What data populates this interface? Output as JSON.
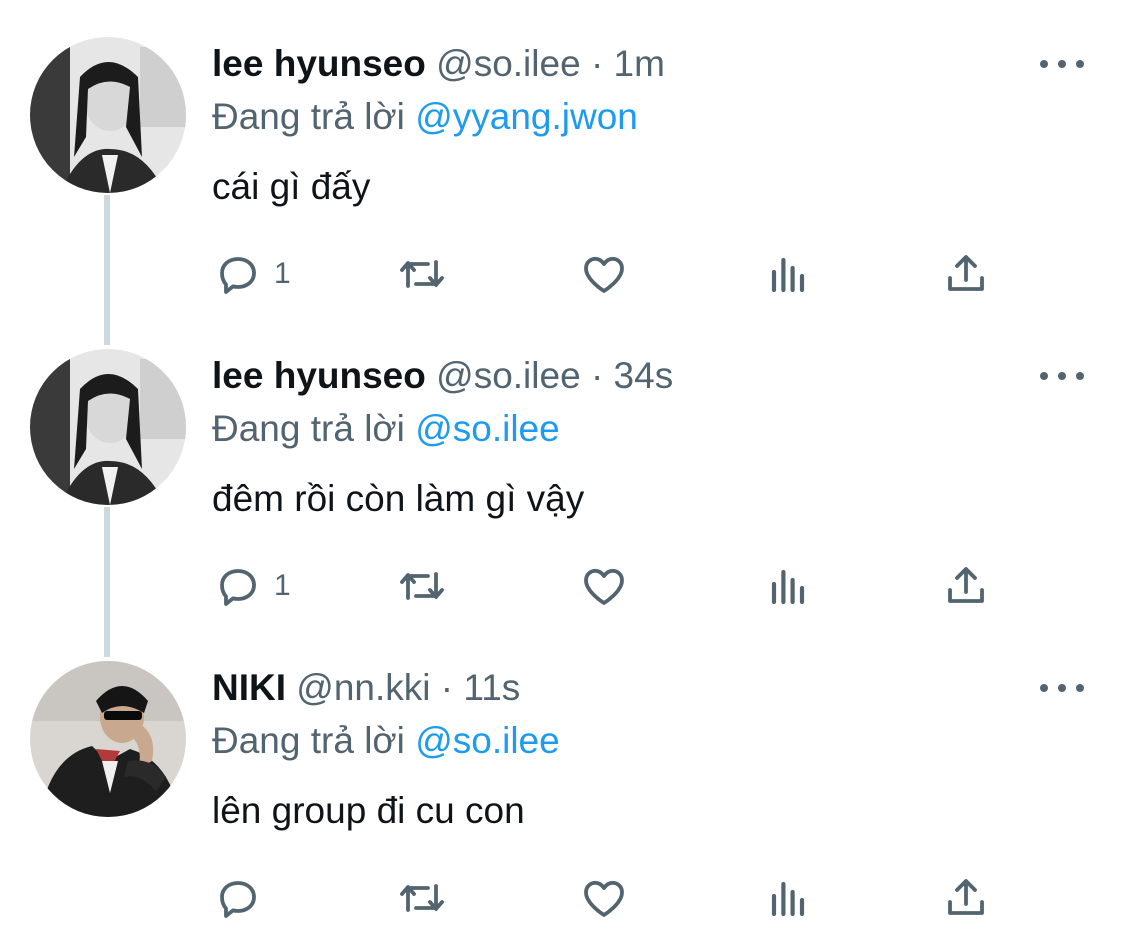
{
  "tweets": [
    {
      "name": "lee hyunseo",
      "handle": "@so.ilee",
      "separator": "·",
      "time": "1m",
      "reply_prefix": "Đang trả lời",
      "reply_to": "@yyang.jwon",
      "text": "cái gì đấy",
      "reply_count": "1",
      "avatar": "avatar-woman-bw"
    },
    {
      "name": "lee hyunseo",
      "handle": "@so.ilee",
      "separator": "·",
      "time": "34s",
      "reply_prefix": "Đang trả lời",
      "reply_to": "@so.ilee",
      "text": "đêm rồi còn làm gì vậy",
      "reply_count": "1",
      "avatar": "avatar-woman-bw"
    },
    {
      "name": "NIKI",
      "handle": "@nn.kki",
      "separator": "·",
      "time": "11s",
      "reply_prefix": "Đang trả lời",
      "reply_to": "@so.ilee",
      "text": "lên group đi cu con",
      "reply_count": "",
      "avatar": "avatar-man-sunglasses"
    }
  ],
  "icons": {
    "reply": "reply-icon",
    "retweet": "retweet-icon",
    "like": "heart-icon",
    "views": "analytics-icon",
    "share": "share-icon",
    "more": "more-icon"
  },
  "colors": {
    "text": "#0f1419",
    "secondary": "#536471",
    "link": "#1d9bf0",
    "thread_line": "#cfd9de"
  }
}
